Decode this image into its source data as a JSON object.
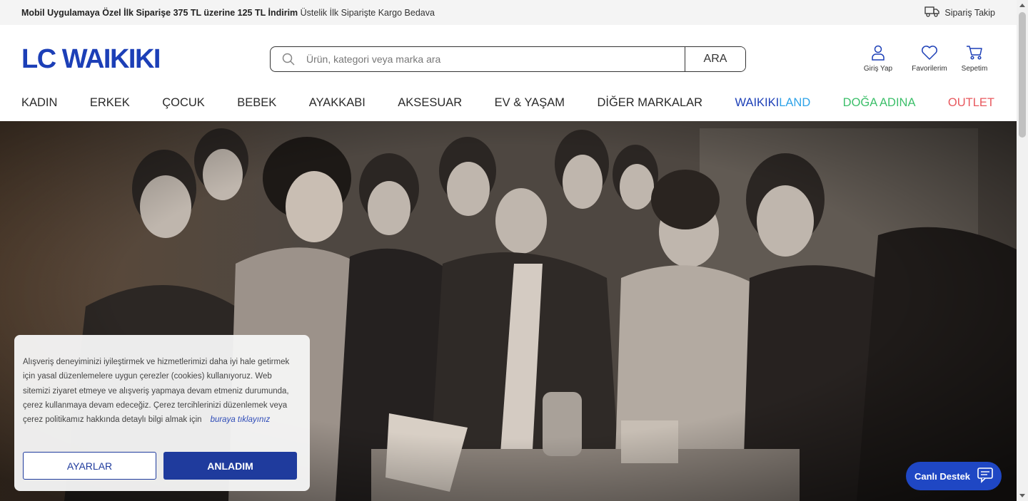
{
  "promo": {
    "bold_text": "Mobil Uygulamaya Özel İlk Siparişe 375 TL üzerine 125 TL İndirim",
    "normal_text": "Üstelik İlk Siparişte Kargo Bedava",
    "track_label": "Sipariş Takip"
  },
  "header": {
    "logo_text": "LC WAIKIKI",
    "search_placeholder": "Ürün, kategori veya marka ara",
    "search_button": "ARA",
    "login_label": "Giriş Yap",
    "favorites_label": "Favorilerim",
    "cart_label": "Sepetim"
  },
  "nav": {
    "items": [
      {
        "label": "KADIN"
      },
      {
        "label": "ERKEK"
      },
      {
        "label": "ÇOCUK"
      },
      {
        "label": "BEBEK"
      },
      {
        "label": "AYAKKABI"
      },
      {
        "label": "AKSESUAR"
      },
      {
        "label": "EV & YAŞAM"
      },
      {
        "label": "DİĞER MARKALAR"
      }
    ],
    "waikiki_part": "WAIKIKI",
    "land_part": "LAND",
    "doga": "DOĞA ADINA",
    "outlet": "OUTLET"
  },
  "colors": {
    "brand_blue": "#1c3fb7",
    "land_blue": "#2ea3e8",
    "doga_green": "#3cbf6a",
    "outlet_red": "#e8585e"
  },
  "cookie": {
    "text": "Alışveriş deneyiminizi iyileştirmek ve hizmetlerimizi daha iyi hale getirmek için yasal düzenlemelere uygun çerezler (cookies) kullanıyoruz. Web sitemizi ziyaret etmeye ve alışveriş yapmaya devam etmeniz durumunda, çerez kullanmaya devam edeceğiz. Çerez tercihlerinizi düzenlemek veya çerez politikamız hakkında detaylı bilgi almak için",
    "link": "buraya tıklayınız",
    "settings_button": "AYARLAR",
    "accept_button": "ANLADIM"
  },
  "live_support": "Canlı Destek"
}
